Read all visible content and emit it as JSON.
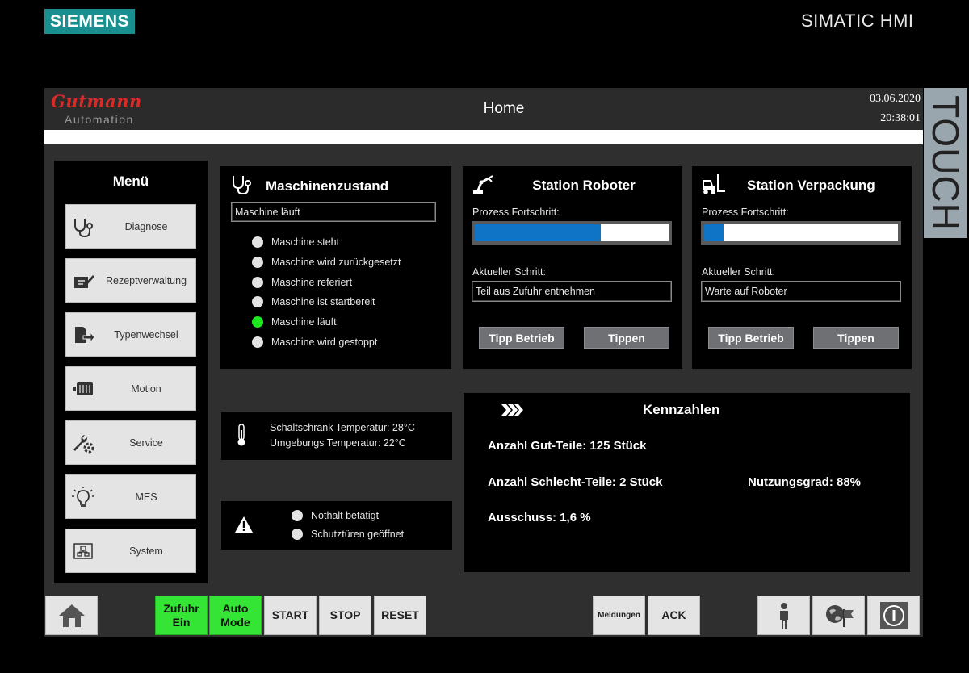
{
  "bezel": {
    "siemens_logo": "SIEMENS",
    "simatic_label": "SIMATIC HMI",
    "touch_label": "TOUCH"
  },
  "header": {
    "brand_top": "Gutmann",
    "brand_bottom": "Automation",
    "title": "Home",
    "date": "03.06.2020",
    "time": "20:38:01"
  },
  "menu": {
    "title": "Menü",
    "items": [
      {
        "label": "Diagnose",
        "icon": "stethoscope-icon"
      },
      {
        "label": "Rezeptverwaltung",
        "icon": "edit-document-icon"
      },
      {
        "label": "Typenwechsel",
        "icon": "document-change-icon"
      },
      {
        "label": "Motion",
        "icon": "motor-icon"
      },
      {
        "label": "Service",
        "icon": "tools-icon"
      },
      {
        "label": "MES",
        "icon": "lightbulb-icon"
      },
      {
        "label": "System",
        "icon": "system-icon"
      }
    ]
  },
  "machine_state": {
    "title": "Maschinenzustand",
    "current": "Maschine läuft",
    "states": [
      {
        "label": "Maschine steht",
        "active": false
      },
      {
        "label": "Maschine wird zurückgesetzt",
        "active": false
      },
      {
        "label": "Maschine referiert",
        "active": false
      },
      {
        "label": "Maschine ist startbereit",
        "active": false
      },
      {
        "label": "Maschine läuft",
        "active": true
      },
      {
        "label": "Maschine wird gestoppt",
        "active": false
      }
    ]
  },
  "station_robot": {
    "title": "Station Roboter",
    "progress_label": "Prozess Fortschritt:",
    "progress_fraction": 0.65,
    "step_label": "Aktueller Schritt:",
    "step_value": "Teil aus Zufuhr entnehmen",
    "btn_tipp_betrieb": "Tipp Betrieb",
    "btn_tippen": "Tippen"
  },
  "station_packing": {
    "title": "Station Verpackung",
    "progress_label": "Prozess Fortschritt:",
    "progress_fraction": 0.1,
    "step_label": "Aktueller Schritt:",
    "step_value": "Warte auf Roboter",
    "btn_tipp_betrieb": "Tipp Betrieb",
    "btn_tippen": "Tippen"
  },
  "temperature": {
    "cabinet": "Schaltschrank Temperatur: 28°C",
    "ambient": "Umgebungs Temperatur: 22°C"
  },
  "alarms": {
    "emergency_stop": "Nothalt betätigt",
    "safety_doors": "Schutztüren geöffnet"
  },
  "kpi": {
    "title": "Kennzahlen",
    "good_parts": "Anzahl Gut-Teile: 125 Stück",
    "bad_parts": "Anzahl Schlecht-Teile: 2 Stück",
    "utilization": "Nutzungsgrad: 88%",
    "scrap": "Ausschuss: 1,6 %"
  },
  "footer": {
    "zufuhr_line1": "Zufuhr",
    "zufuhr_line2": "Ein",
    "auto_line1": "Auto",
    "auto_line2": "Mode",
    "start": "START",
    "stop": "STOP",
    "reset": "RESET",
    "meldungen": "Meldungen",
    "ack": "ACK"
  },
  "colors": {
    "accent_blue": "#0f73c6",
    "active_green": "#1ee81e",
    "brand_red": "#d92a2a",
    "siemens_teal": "#1a8f8f"
  }
}
